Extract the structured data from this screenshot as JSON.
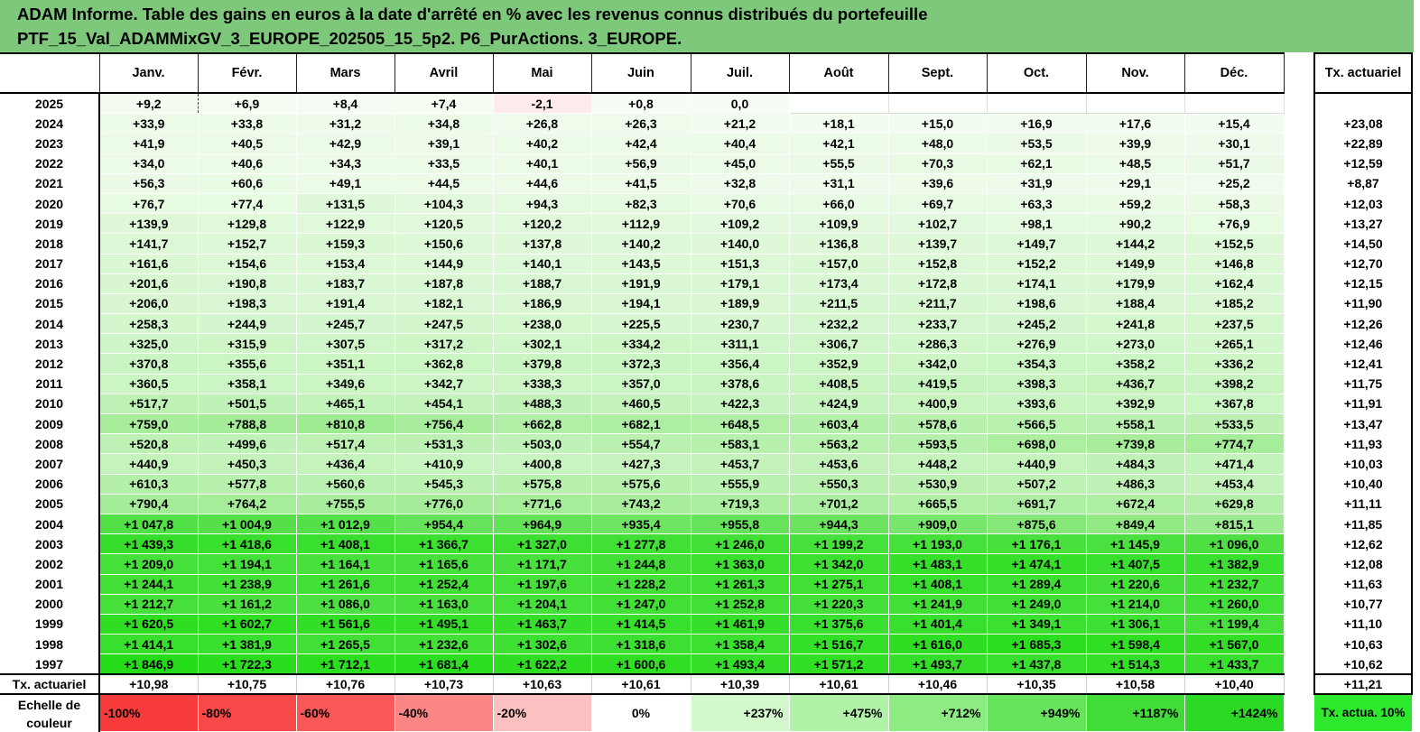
{
  "title": {
    "line1": "ADAM Informe. Table des gains en euros à la date d'arrêté en % avec les revenus connus distribués du portefeuille",
    "line2": "PTF_15_Val_ADAMMixGV_3_EUROPE_202505_15_5p2. P6_PurActions. 3_EUROPE."
  },
  "months": [
    "Janv.",
    "Févr.",
    "Mars",
    "Avril",
    "Mai",
    "Juin",
    "Juil.",
    "Août",
    "Sept.",
    "Oct.",
    "Nov.",
    "Déc."
  ],
  "tx_header": "Tx. actuariel",
  "rows": [
    {
      "year": "2025",
      "values": [
        "+9,2",
        "+6,9",
        "+8,4",
        "+7,4",
        "-2,1",
        "+0,8",
        "0,0",
        "",
        "",
        "",
        "",
        ""
      ],
      "tx": ""
    },
    {
      "year": "2024",
      "values": [
        "+33,9",
        "+33,8",
        "+31,2",
        "+34,8",
        "+26,8",
        "+26,3",
        "+21,2",
        "+18,1",
        "+15,0",
        "+16,9",
        "+17,6",
        "+15,4"
      ],
      "tx": "+23,08"
    },
    {
      "year": "2023",
      "values": [
        "+41,9",
        "+40,5",
        "+42,9",
        "+39,1",
        "+40,2",
        "+42,4",
        "+40,4",
        "+42,1",
        "+48,0",
        "+53,5",
        "+39,9",
        "+30,1"
      ],
      "tx": "+22,89"
    },
    {
      "year": "2022",
      "values": [
        "+34,0",
        "+40,6",
        "+34,3",
        "+33,5",
        "+40,1",
        "+56,9",
        "+45,0",
        "+55,5",
        "+70,3",
        "+62,1",
        "+48,5",
        "+51,7"
      ],
      "tx": "+12,59"
    },
    {
      "year": "2021",
      "values": [
        "+56,3",
        "+60,6",
        "+49,1",
        "+44,5",
        "+44,6",
        "+41,5",
        "+32,8",
        "+31,1",
        "+39,6",
        "+31,9",
        "+29,1",
        "+25,2"
      ],
      "tx": "+8,87"
    },
    {
      "year": "2020",
      "values": [
        "+76,7",
        "+77,4",
        "+131,5",
        "+104,3",
        "+94,3",
        "+82,3",
        "+70,6",
        "+66,0",
        "+69,7",
        "+63,3",
        "+59,2",
        "+58,3"
      ],
      "tx": "+12,03"
    },
    {
      "year": "2019",
      "values": [
        "+139,9",
        "+129,8",
        "+122,9",
        "+120,5",
        "+120,2",
        "+112,9",
        "+109,2",
        "+109,9",
        "+102,7",
        "+98,1",
        "+90,2",
        "+76,9"
      ],
      "tx": "+13,27"
    },
    {
      "year": "2018",
      "values": [
        "+141,7",
        "+152,7",
        "+159,3",
        "+150,6",
        "+137,8",
        "+140,2",
        "+140,0",
        "+136,8",
        "+139,7",
        "+149,7",
        "+144,2",
        "+152,5"
      ],
      "tx": "+14,50"
    },
    {
      "year": "2017",
      "values": [
        "+161,6",
        "+154,6",
        "+153,4",
        "+144,9",
        "+140,1",
        "+143,5",
        "+151,3",
        "+157,0",
        "+152,8",
        "+152,2",
        "+149,9",
        "+146,8"
      ],
      "tx": "+12,70"
    },
    {
      "year": "2016",
      "values": [
        "+201,6",
        "+190,8",
        "+183,7",
        "+187,8",
        "+188,7",
        "+191,9",
        "+179,1",
        "+173,4",
        "+172,8",
        "+174,1",
        "+179,9",
        "+162,4"
      ],
      "tx": "+12,15"
    },
    {
      "year": "2015",
      "values": [
        "+206,0",
        "+198,3",
        "+191,4",
        "+182,1",
        "+186,9",
        "+194,1",
        "+189,9",
        "+211,5",
        "+211,7",
        "+198,6",
        "+188,4",
        "+185,2"
      ],
      "tx": "+11,90"
    },
    {
      "year": "2014",
      "values": [
        "+258,3",
        "+244,9",
        "+245,7",
        "+247,5",
        "+238,0",
        "+225,5",
        "+230,7",
        "+232,2",
        "+233,7",
        "+245,2",
        "+241,8",
        "+237,5"
      ],
      "tx": "+12,26"
    },
    {
      "year": "2013",
      "values": [
        "+325,0",
        "+315,9",
        "+307,5",
        "+317,2",
        "+302,1",
        "+334,2",
        "+311,1",
        "+306,7",
        "+286,3",
        "+276,9",
        "+273,0",
        "+265,1"
      ],
      "tx": "+12,46"
    },
    {
      "year": "2012",
      "values": [
        "+370,8",
        "+355,6",
        "+351,1",
        "+362,8",
        "+379,8",
        "+372,3",
        "+356,4",
        "+352,9",
        "+342,0",
        "+354,3",
        "+358,2",
        "+336,2"
      ],
      "tx": "+12,41"
    },
    {
      "year": "2011",
      "values": [
        "+360,5",
        "+358,1",
        "+349,6",
        "+342,7",
        "+338,3",
        "+357,0",
        "+378,6",
        "+408,5",
        "+419,5",
        "+398,3",
        "+436,7",
        "+398,2"
      ],
      "tx": "+11,75"
    },
    {
      "year": "2010",
      "values": [
        "+517,7",
        "+501,5",
        "+465,1",
        "+454,1",
        "+488,3",
        "+460,5",
        "+422,3",
        "+424,9",
        "+400,9",
        "+393,6",
        "+392,9",
        "+367,8"
      ],
      "tx": "+11,91"
    },
    {
      "year": "2009",
      "values": [
        "+759,0",
        "+788,8",
        "+810,8",
        "+756,4",
        "+662,8",
        "+682,1",
        "+648,5",
        "+603,4",
        "+578,6",
        "+566,5",
        "+558,1",
        "+533,5"
      ],
      "tx": "+13,47"
    },
    {
      "year": "2008",
      "values": [
        "+520,8",
        "+499,6",
        "+517,4",
        "+531,3",
        "+503,0",
        "+554,7",
        "+583,1",
        "+563,2",
        "+593,5",
        "+698,0",
        "+739,8",
        "+774,7"
      ],
      "tx": "+11,93"
    },
    {
      "year": "2007",
      "values": [
        "+440,9",
        "+450,3",
        "+436,4",
        "+410,9",
        "+400,8",
        "+427,3",
        "+453,7",
        "+453,6",
        "+448,2",
        "+440,9",
        "+484,3",
        "+471,4"
      ],
      "tx": "+10,03"
    },
    {
      "year": "2006",
      "values": [
        "+610,3",
        "+577,8",
        "+560,6",
        "+545,3",
        "+575,8",
        "+575,6",
        "+555,9",
        "+550,3",
        "+530,9",
        "+507,2",
        "+486,3",
        "+453,4"
      ],
      "tx": "+10,40"
    },
    {
      "year": "2005",
      "values": [
        "+790,4",
        "+764,2",
        "+755,5",
        "+776,0",
        "+771,6",
        "+743,2",
        "+719,3",
        "+701,2",
        "+665,5",
        "+691,7",
        "+672,4",
        "+629,8"
      ],
      "tx": "+11,11"
    },
    {
      "year": "2004",
      "values": [
        "+1 047,8",
        "+1 004,9",
        "+1 012,9",
        "+954,4",
        "+964,9",
        "+935,4",
        "+955,8",
        "+944,3",
        "+909,0",
        "+875,6",
        "+849,4",
        "+815,1"
      ],
      "tx": "+11,85"
    },
    {
      "year": "2003",
      "values": [
        "+1 439,3",
        "+1 418,6",
        "+1 408,1",
        "+1 366,7",
        "+1 327,0",
        "+1 277,8",
        "+1 246,0",
        "+1 199,2",
        "+1 193,0",
        "+1 176,1",
        "+1 145,9",
        "+1 096,0"
      ],
      "tx": "+12,62"
    },
    {
      "year": "2002",
      "values": [
        "+1 209,0",
        "+1 194,1",
        "+1 164,1",
        "+1 165,6",
        "+1 171,7",
        "+1 244,8",
        "+1 363,0",
        "+1 342,0",
        "+1 483,1",
        "+1 474,1",
        "+1 407,5",
        "+1 382,9"
      ],
      "tx": "+12,08"
    },
    {
      "year": "2001",
      "values": [
        "+1 244,1",
        "+1 238,9",
        "+1 261,6",
        "+1 252,4",
        "+1 197,6",
        "+1 228,2",
        "+1 261,3",
        "+1 275,1",
        "+1 408,1",
        "+1 289,4",
        "+1 220,6",
        "+1 232,7"
      ],
      "tx": "+11,63"
    },
    {
      "year": "2000",
      "values": [
        "+1 212,7",
        "+1 161,2",
        "+1 086,0",
        "+1 163,0",
        "+1 204,1",
        "+1 247,0",
        "+1 252,8",
        "+1 220,3",
        "+1 241,9",
        "+1 249,0",
        "+1 214,0",
        "+1 260,0"
      ],
      "tx": "+10,77"
    },
    {
      "year": "1999",
      "values": [
        "+1 620,5",
        "+1 602,7",
        "+1 561,6",
        "+1 495,1",
        "+1 463,7",
        "+1 414,5",
        "+1 461,9",
        "+1 375,6",
        "+1 401,4",
        "+1 349,1",
        "+1 306,1",
        "+1 199,4"
      ],
      "tx": "+11,10"
    },
    {
      "year": "1998",
      "values": [
        "+1 414,1",
        "+1 381,9",
        "+1 265,5",
        "+1 232,6",
        "+1 302,6",
        "+1 318,6",
        "+1 358,4",
        "+1 516,7",
        "+1 616,0",
        "+1 685,3",
        "+1 598,4",
        "+1 567,0"
      ],
      "tx": "+10,63"
    },
    {
      "year": "1997",
      "values": [
        "+1 846,9",
        "+1 722,3",
        "+1 712,1",
        "+1 681,4",
        "+1 622,2",
        "+1 600,6",
        "+1 493,4",
        "+1 571,2",
        "+1 493,7",
        "+1 437,8",
        "+1 514,3",
        "+1 433,7"
      ],
      "tx": "+10,62"
    }
  ],
  "average_row": {
    "label": "Tx. actuariel",
    "values": [
      "+10,98",
      "+10,75",
      "+10,76",
      "+10,73",
      "+10,63",
      "+10,61",
      "+10,39",
      "+10,61",
      "+10,46",
      "+10,35",
      "+10,58",
      "+10,40"
    ],
    "tx": "+11,21"
  },
  "legend": {
    "label": "Echelle de couleur",
    "items": [
      {
        "text": "-100%",
        "color": "#f83c3c"
      },
      {
        "text": "-80%",
        "color": "#f94848"
      },
      {
        "text": "-60%",
        "color": "#fa5858"
      },
      {
        "text": "-40%",
        "color": "#fb8686"
      },
      {
        "text": "-20%",
        "color": "#fdc0c0"
      },
      {
        "text": "0%",
        "color": "#ffffff"
      },
      {
        "text": "+237%",
        "color": "#d2f8cc"
      },
      {
        "text": "+475%",
        "color": "#b2f2a8"
      },
      {
        "text": "+712%",
        "color": "#8cec82"
      },
      {
        "text": "+949%",
        "color": "#66e45c"
      },
      {
        "text": "+1187%",
        "color": "#42dc38"
      },
      {
        "text": "+1424%",
        "color": "#2bd824"
      }
    ],
    "tx_label": "Tx. actua. 10%",
    "tx_color": "#2ee82e"
  },
  "colors": {
    "title_bg": "#7dc87a",
    "negative_cell": "#fdeaea"
  }
}
